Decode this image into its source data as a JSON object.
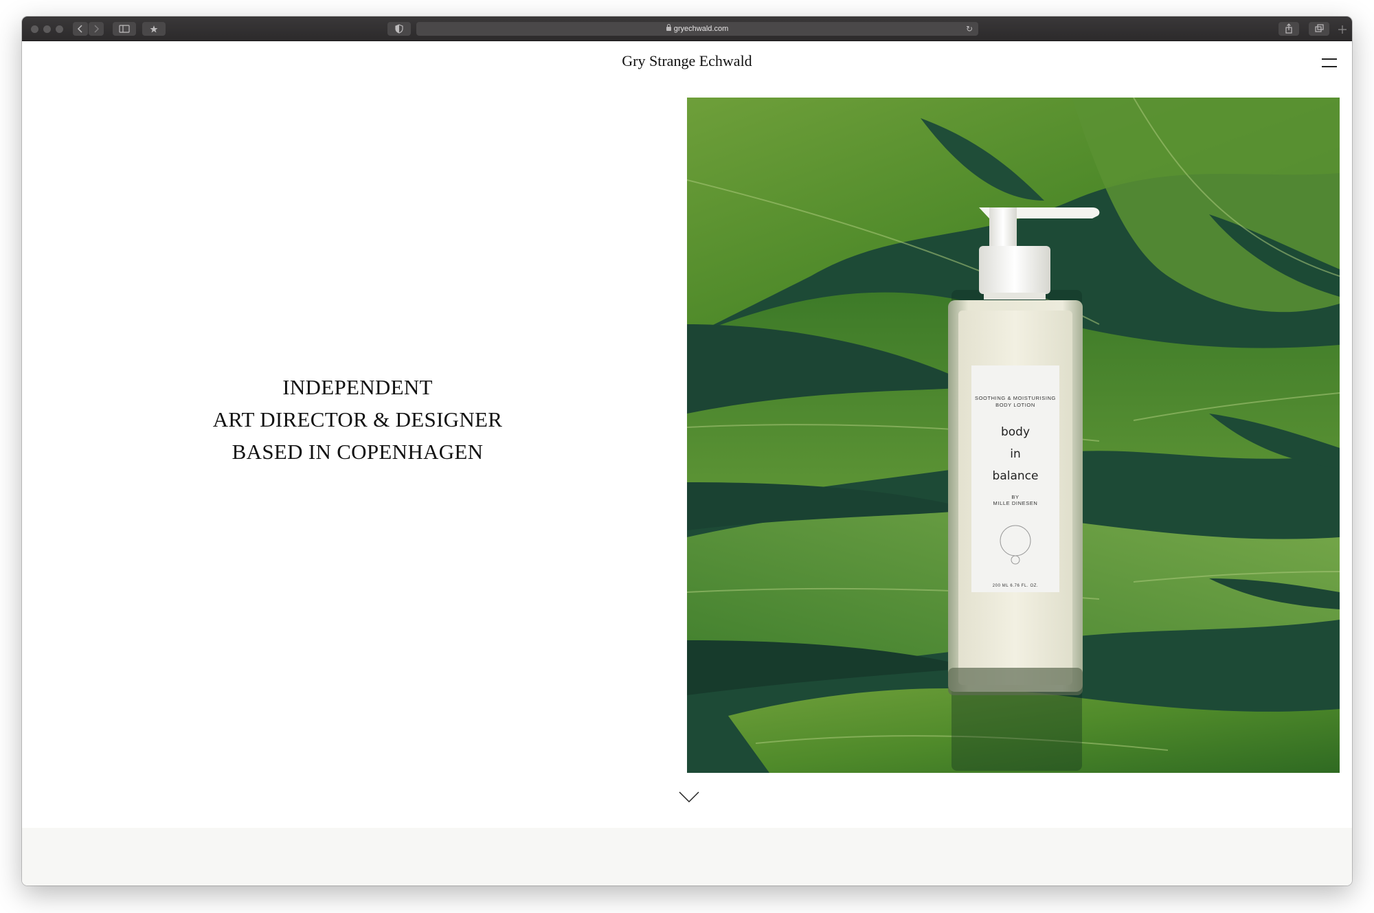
{
  "browser": {
    "url": "gryechwald.com",
    "reading_list_icon": "star-icon",
    "shield_icon": "shield-icon"
  },
  "site": {
    "title": "Gry Strange Echwald",
    "menu_icon": "hamburger-menu-icon"
  },
  "hero": {
    "lines": [
      "INDEPENDENT",
      "ART DIRECTOR & DESIGNER",
      "BASED IN COPENHAGEN"
    ],
    "image": {
      "subject": "lotion bottle on monstera leaves",
      "label": {
        "top_line_1": "SOOTHING & MOISTURISING",
        "top_line_2": "BODY LOTION",
        "word_1": "body",
        "word_2": "in",
        "word_3": "balance",
        "by": "BY",
        "brand": "MILLE DINESEN",
        "volume": "200 ML  6.76 FL. OZ."
      }
    },
    "scroll_icon": "chevron-down-icon"
  },
  "colors": {
    "titlebar": "#2f2d2e",
    "leaf_green": "#4f8a2a",
    "shadow_green": "#1d4a36",
    "page_bg": "#ffffff",
    "footer_band": "#f7f7f5"
  }
}
